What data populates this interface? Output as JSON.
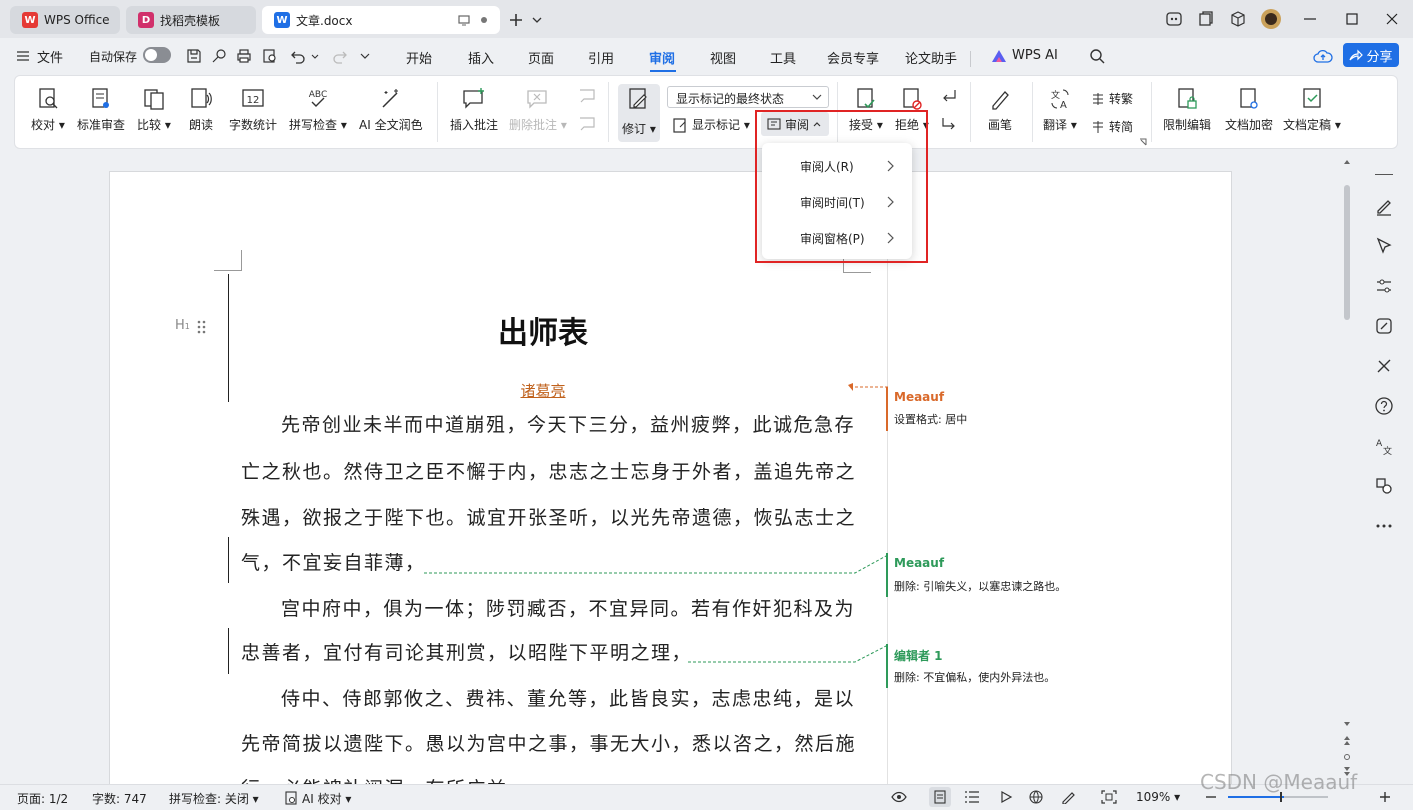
{
  "tabs": [
    {
      "label": "WPS Office",
      "logo": "W"
    },
    {
      "label": "找稻壳模板",
      "logo": "D"
    },
    {
      "label": "文章.docx",
      "logo": "W"
    }
  ],
  "menubar": {
    "file": "文件",
    "autosave": "自动保存",
    "items": [
      "开始",
      "插入",
      "页面",
      "引用",
      "审阅",
      "视图",
      "工具",
      "会员专享",
      "论文助手"
    ],
    "active_index": 4,
    "wps_ai": "WPS AI",
    "share": "分享"
  },
  "ribbon": {
    "proofread": "校对",
    "standard_review": "标准审查",
    "compare": "比较",
    "read_aloud": "朗读",
    "word_count": "字数统计",
    "word_count_icon_text": "12",
    "spell_check": "拼写检查",
    "spell_icon_text": "ABC",
    "ai_polish": "AI 全文润色",
    "insert_comment": "插入批注",
    "delete_comment": "删除批注",
    "track_changes": "修订",
    "display_mode": "显示标记的最终状态",
    "show_markup": "显示标记",
    "review": "审阅",
    "accept": "接受",
    "reject": "拒绝",
    "pen": "画笔",
    "translate": "翻译",
    "to_traditional": "转繁",
    "to_simplified": "转简",
    "restrict_edit": "限制编辑",
    "encrypt": "文档加密",
    "finalize": "文档定稿"
  },
  "dropdown": {
    "items": [
      "审阅人(R)",
      "审阅时间(T)",
      "审阅窗格(P)"
    ]
  },
  "document": {
    "heading_marker": "H",
    "title": "出师表",
    "author": "诸葛亮",
    "lines": [
      "先帝创业未半而中道崩殂，今天下三分，益州疲弊，此诚危急存",
      "亡之秋也。然侍卫之臣不懈于内，忠志之士忘身于外者，盖追先帝之",
      "殊遇，欲报之于陛下也。诚宜开张圣听，以光先帝遗德，恢弘志士之",
      "气，不宜妄自菲薄，",
      "宫中府中，俱为一体；陟罚臧否，不宜异同。若有作奸犯科及为",
      "忠善者，宜付有司论其刑赏，以昭陛下平明之理，",
      "侍中、侍郎郭攸之、费祎、董允等，此皆良实，志虑忠纯，是以",
      "先帝简拔以遗陛下。愚以为宫中之事，事无大小，悉以咨之，然后施",
      "行，必能裨补阙漏，有所广益。"
    ]
  },
  "comments": [
    {
      "author": "Meaauf",
      "text": "设置格式: 居中",
      "color": "#d9692a"
    },
    {
      "author": "Meaauf",
      "text": "删除: 引喻失义，以塞忠谏之路也。",
      "color": "#2e9a5a"
    },
    {
      "author": "编辑者 1",
      "text": "删除: 不宜偏私，使内外异法也。",
      "color": "#2e9a5a"
    }
  ],
  "status": {
    "page": "页面: 1/2",
    "words": "字数: 747",
    "spell": "拼写检查: 关闭",
    "ai_check": "AI 校对",
    "zoom": "109%"
  },
  "watermark": "CSDN @Meaauf",
  "colors": {
    "accent": "#1f6fe5",
    "red_box": "#e02424",
    "active_tab": "#1f6fe5"
  }
}
